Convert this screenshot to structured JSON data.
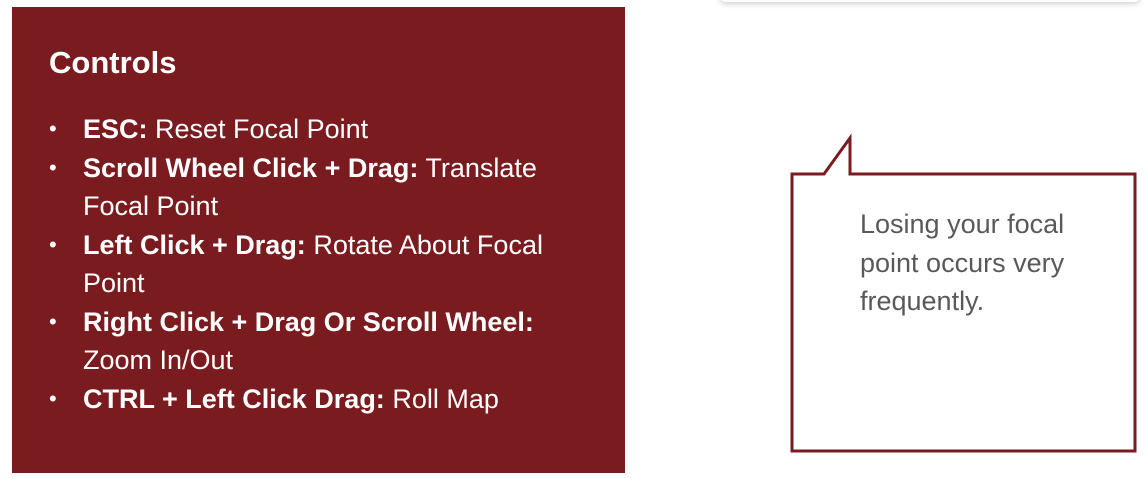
{
  "controls": {
    "title": "Controls",
    "items": [
      {
        "key": "ESC:",
        "action": " Reset Focal Point"
      },
      {
        "key": "Scroll Wheel Click + Drag:",
        "action": " Translate Focal Point"
      },
      {
        "key": "Left Click + Drag:",
        "action": " Rotate About Focal Point"
      },
      {
        "key": "Right Click + Drag Or Scroll Wheel:",
        "action": " Zoom In/Out"
      },
      {
        "key": "CTRL + Left Click Drag:",
        "action": " Roll Map"
      }
    ],
    "bullet": "•"
  },
  "callout": {
    "text": "Losing your focal point occurs very frequently."
  },
  "colors": {
    "panel_background": "#7a1c1f",
    "panel_text": "#ffffff",
    "callout_border": "#7a1c1f",
    "callout_text": "#595959"
  }
}
